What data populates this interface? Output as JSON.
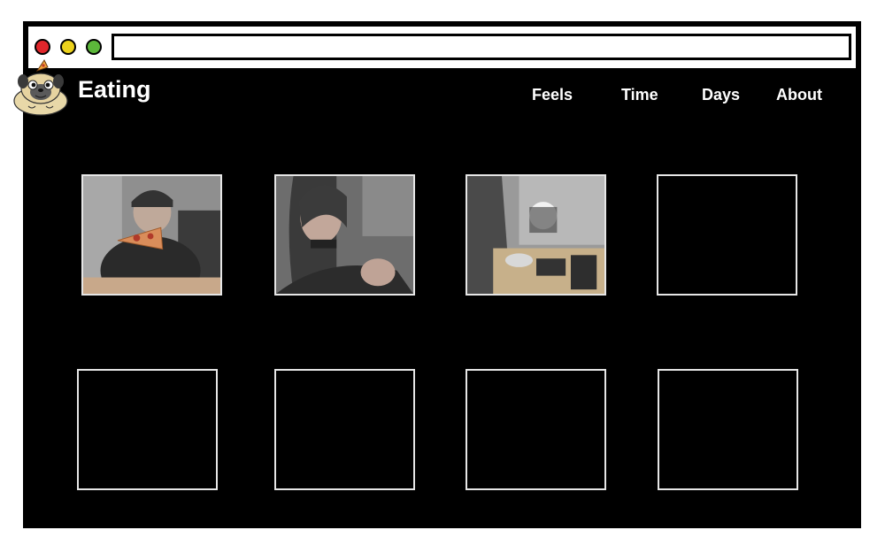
{
  "window": {
    "traffic_lights": [
      "#e0262b",
      "#ecd21c",
      "#5cb83a"
    ],
    "url_bar": ""
  },
  "header": {
    "title": "Eating",
    "logo_icon": "pug-with-pizza-icon",
    "nav": [
      "Feels",
      "Time",
      "Days",
      "About"
    ]
  },
  "grid": {
    "tiles": [
      {
        "kind": "photo",
        "subject": "person eating pizza"
      },
      {
        "kind": "photo",
        "subject": "person talking"
      },
      {
        "kind": "photo",
        "subject": "person preparing food at table"
      },
      {
        "kind": "empty"
      },
      {
        "kind": "empty"
      },
      {
        "kind": "empty"
      },
      {
        "kind": "empty"
      },
      {
        "kind": "empty"
      }
    ]
  }
}
